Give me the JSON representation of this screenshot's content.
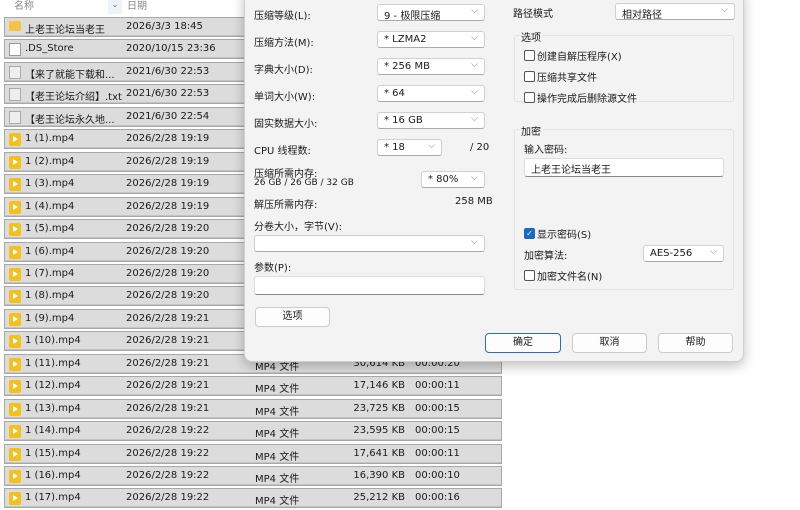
{
  "header": {
    "col_name": "名称",
    "col_date": "日期"
  },
  "files": [
    {
      "name": "上老王论坛当老王",
      "date": "2026/3/3 18:45",
      "icon": "folder"
    },
    {
      "name": ".DS_Store",
      "date": "2020/10/15 23:36",
      "icon": "doc"
    },
    {
      "name": "【来了就能下载和...",
      "date": "2021/6/30 22:53",
      "icon": "txt"
    },
    {
      "name": "【老王论坛介绍】.txt",
      "date": "2021/6/30 22:53",
      "icon": "txt"
    },
    {
      "name": "【老王论坛永久地...",
      "date": "2021/6/30 22:54",
      "icon": "txt"
    },
    {
      "name": "1 (1).mp4",
      "date": "2026/2/28 19:19",
      "icon": "mp4"
    },
    {
      "name": "1 (2).mp4",
      "date": "2026/2/28 19:19",
      "icon": "mp4"
    },
    {
      "name": "1 (3).mp4",
      "date": "2026/2/28 19:19",
      "icon": "mp4"
    },
    {
      "name": "1 (4).mp4",
      "date": "2026/2/28 19:19",
      "icon": "mp4"
    },
    {
      "name": "1 (5).mp4",
      "date": "2026/2/28 19:20",
      "icon": "mp4"
    },
    {
      "name": "1 (6).mp4",
      "date": "2026/2/28 19:20",
      "icon": "mp4"
    },
    {
      "name": "1 (7).mp4",
      "date": "2026/2/28 19:20",
      "icon": "mp4"
    },
    {
      "name": "1 (8).mp4",
      "date": "2026/2/28 19:20",
      "icon": "mp4"
    },
    {
      "name": "1 (9).mp4",
      "date": "2026/2/28 19:21",
      "icon": "mp4"
    },
    {
      "name": "1 (10).mp4",
      "date": "2026/2/28 19:21",
      "icon": "mp4"
    },
    {
      "name": "1 (11).mp4",
      "date": "2026/2/28 19:21",
      "icon": "mp4",
      "type": "MP4 文件",
      "size": "30,614 KB",
      "duration": "00:00:20"
    },
    {
      "name": "1 (12).mp4",
      "date": "2026/2/28 19:21",
      "icon": "mp4",
      "type": "MP4 文件",
      "size": "17,146 KB",
      "duration": "00:00:11"
    },
    {
      "name": "1 (13).mp4",
      "date": "2026/2/28 19:21",
      "icon": "mp4",
      "type": "MP4 文件",
      "size": "23,725 KB",
      "duration": "00:00:15"
    },
    {
      "name": "1 (14).mp4",
      "date": "2026/2/28 19:22",
      "icon": "mp4",
      "type": "MP4 文件",
      "size": "23,595 KB",
      "duration": "00:00:15"
    },
    {
      "name": "1 (15).mp4",
      "date": "2026/2/28 19:22",
      "icon": "mp4",
      "type": "MP4 文件",
      "size": "17,641 KB",
      "duration": "00:00:11"
    },
    {
      "name": "1 (16).mp4",
      "date": "2026/2/28 19:22",
      "icon": "mp4",
      "type": "MP4 文件",
      "size": "16,390 KB",
      "duration": "00:00:10"
    },
    {
      "name": "1 (17).mp4",
      "date": "2026/2/28 19:22",
      "icon": "mp4",
      "type": "MP4 文件",
      "size": "25,212 KB",
      "duration": "00:00:16"
    }
  ],
  "dialog": {
    "level_label": "压缩等级(L):",
    "level_value": "9 - 极限压缩",
    "method_label": "压缩方法(M):",
    "method_value": "* LZMA2",
    "dict_label": "字典大小(D):",
    "dict_value": "* 256 MB",
    "word_label": "单词大小(W):",
    "word_value": "* 64",
    "solid_label": "固实数据大小:",
    "solid_value": "* 16 GB",
    "cpu_label": "CPU 线程数:",
    "cpu_value": "* 18",
    "cpu_max": "/ 20",
    "mem_label": "压缩所需内存:",
    "mem_detail": "26 GB / 26 GB / 32 GB",
    "mem_value": "* 80%",
    "decomp_label": "解压所需内存:",
    "decomp_value": "258 MB",
    "volume_label": "分卷大小，字节(V):",
    "volume_value": "",
    "params_label": "参数(P):",
    "params_value": "",
    "options_button": "选项",
    "path_label": "路径模式",
    "path_value": "相对路径",
    "options_group": "选项",
    "opt_sfx": "创建自解压程序(X)",
    "opt_shared": "压缩共享文件",
    "opt_delete": "操作完成后删除源文件",
    "enc_group": "加密",
    "pwd_label": "输入密码:",
    "pwd_value": "上老王论坛当老王",
    "show_pwd": "显示密码(S)",
    "enc_method_label": "加密算法:",
    "enc_method_value": "AES-256",
    "enc_names": "加密文件名(N)",
    "ok": "确定",
    "cancel": "取消",
    "help": "帮助"
  }
}
